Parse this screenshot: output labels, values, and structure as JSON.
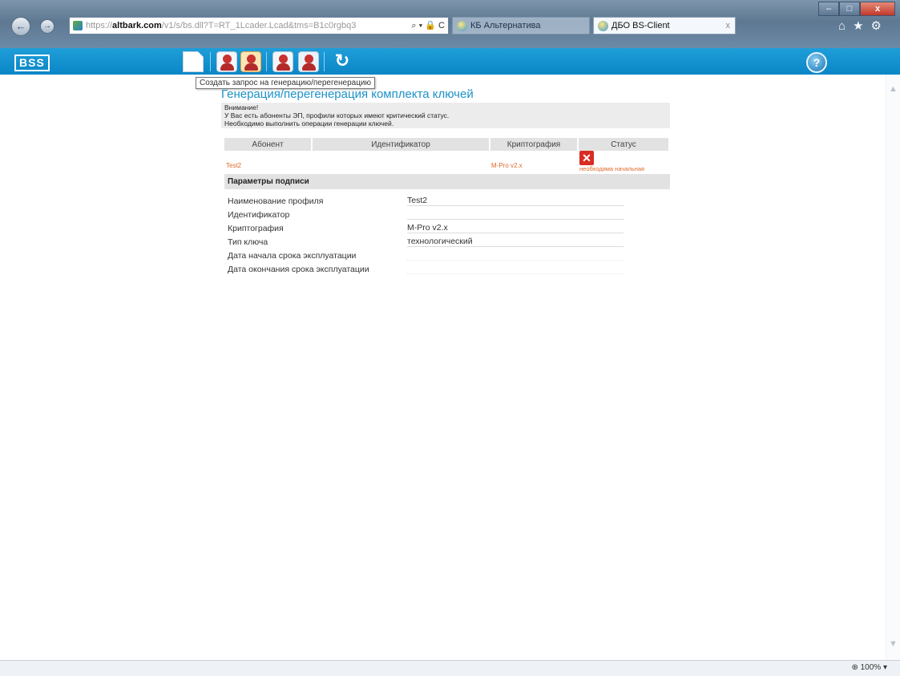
{
  "browser": {
    "nav": {
      "back": "←",
      "forward": "→"
    },
    "address": {
      "prefix": "https://",
      "host": "altbark.com",
      "path": "/v1/s/bs.dll?T=RT_1Lcader.Lcad&tms=B1c0rgbq3",
      "actions": "⌕ ▾ 🔒 C"
    },
    "tabs": [
      {
        "label": "КБ Альтернатива",
        "active": false
      },
      {
        "label": "ДБО BS-Client",
        "active": true,
        "close": "x"
      }
    ],
    "window_buttons": {
      "minimize": "–",
      "maximize": "□",
      "close": "x"
    },
    "toolbar_icons": "⌂★⚙",
    "zoom": "100%"
  },
  "app": {
    "logo": "BSS",
    "help": "?",
    "refresh": "↻",
    "tooltip": "Создать запрос на генерацию/перегенерацию"
  },
  "page": {
    "title": "Генерация/перегенерация комплекта ключей",
    "warning": {
      "heading": "Внимание!",
      "line1": "У Вас есть абоненты ЭП, профили которых имеют критический статус.",
      "line2": "Необходимо выполнить операции генерации ключей."
    },
    "table": {
      "headers": [
        "Абонент",
        "Идентификатор",
        "Криптография",
        "Статус"
      ],
      "rows": [
        {
          "subscriber": "Test2",
          "identifier": "",
          "crypto": "M-Pro v2.x",
          "status": "необходима начальная генерация"
        }
      ]
    },
    "params": {
      "header": "Параметры подписи",
      "rows": [
        {
          "label": "Наименование профиля",
          "value": "Test2"
        },
        {
          "label": "Идентификатор",
          "value": ""
        },
        {
          "label": "Криптография",
          "value": "M-Pro v2.x"
        },
        {
          "label": "Тип ключа",
          "value": "технологический"
        },
        {
          "label": "Дата начала срока эксплуатации",
          "value": ""
        },
        {
          "label": "Дата окончания срока эксплуатации",
          "value": ""
        }
      ]
    }
  },
  "colors": {
    "accent": "#0a86c6",
    "title": "#1c92c8",
    "error": "#d92c22",
    "link": "#e06a2a"
  },
  "icons": [
    "new-document-icon",
    "add-user-icon",
    "key-user-icon",
    "user-icon",
    "user-outline-icon",
    "refresh-icon",
    "help-icon"
  ]
}
